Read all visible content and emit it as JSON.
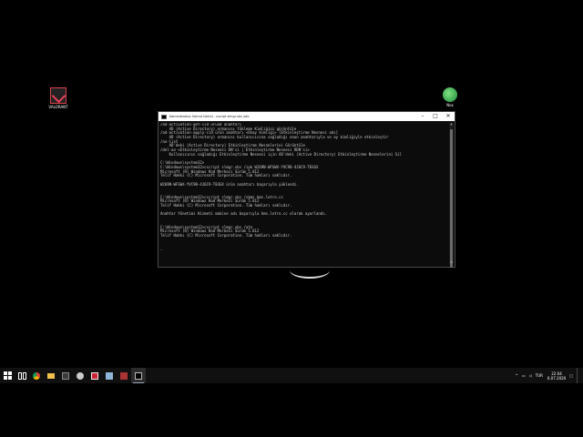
{
  "desktop": {
    "icons": [
      {
        "label": "VALORANT"
      },
      {
        "label": "Nox"
      }
    ]
  },
  "console": {
    "title": "Administrator: Komut İstemi - cscript slmgr.vbs /ato",
    "buttons": {
      "minimize": "–",
      "maximize": "□",
      "close": "✕"
    },
    "lines": [
      "/ad-activation-get-iid üründ anahtarı",
      "    AD (Active Directory) ormanını Yükleme Kimliğini görüntüle",
      "/ad-activation-apply-cid ürün anahtarı <Onay kimliği> [Etkinleştirme Nesnesi adı]",
      "    AD (Active Directory) ormanını kullanıcısına sağladığı onun anahtarıyla ve ay kimliğiyle etkinleştir",
      "/ao-list",
      "    AD'deki (Active Directory) Etkinleştirme Nesnelerini Görüntüle",
      "/del-ao <Etkinleştirme Nesnesi DN'si | Etkinleştirme Nesnesi RDN'si>",
      "    Kullanıcının sağladığı Etkinleştirme Nesnesi için AD'deki (Active Directory) Etkinleştirme Nesnelerini Sil",
      "",
      "C:\\Windows\\system32>",
      "C:\\Windows\\system32>cscript slmgr.vbs /ipk W269N-WFGWX-YVC9B-4J6C9-T83GX",
      "Microsoft (R) Windows Kod Merkezi Sürüm 5.812",
      "Telif Hakkı (C) Microsoft Corporation. Tüm hakları saklıdır.",
      "",
      "W269N-WFGWX-YVC9B-4J6C9-T83GX ürün anahtarı başarıyla yüklendi.",
      "",
      "",
      "C:\\Windows\\system32>cscript slmgr.vbs /skms kms.lotro.cc",
      "Microsoft (R) Windows Kod Merkezi Sürüm 5.812",
      "Telif Hakkı (C) Microsoft Corporation. Tüm hakları saklıdır.",
      "",
      "Anahtar Yönetimi Hizmeti makine adı başarıyla kms.lotro.cc olarak ayarlandı.",
      "",
      "",
      "C:\\Windows\\system32>cscript slmgr.vbs /ato",
      "Microsoft (R) Windows Kod Merkezi Sürüm 5.812",
      "Telif Hakkı (C) Microsoft Corporation. Tüm hakları saklıdır.",
      "",
      "",
      "_"
    ]
  },
  "taskbar": {
    "tray": {
      "chevron": "^",
      "language": "TUR",
      "time": "22:04",
      "date": "6.07.2020"
    }
  }
}
